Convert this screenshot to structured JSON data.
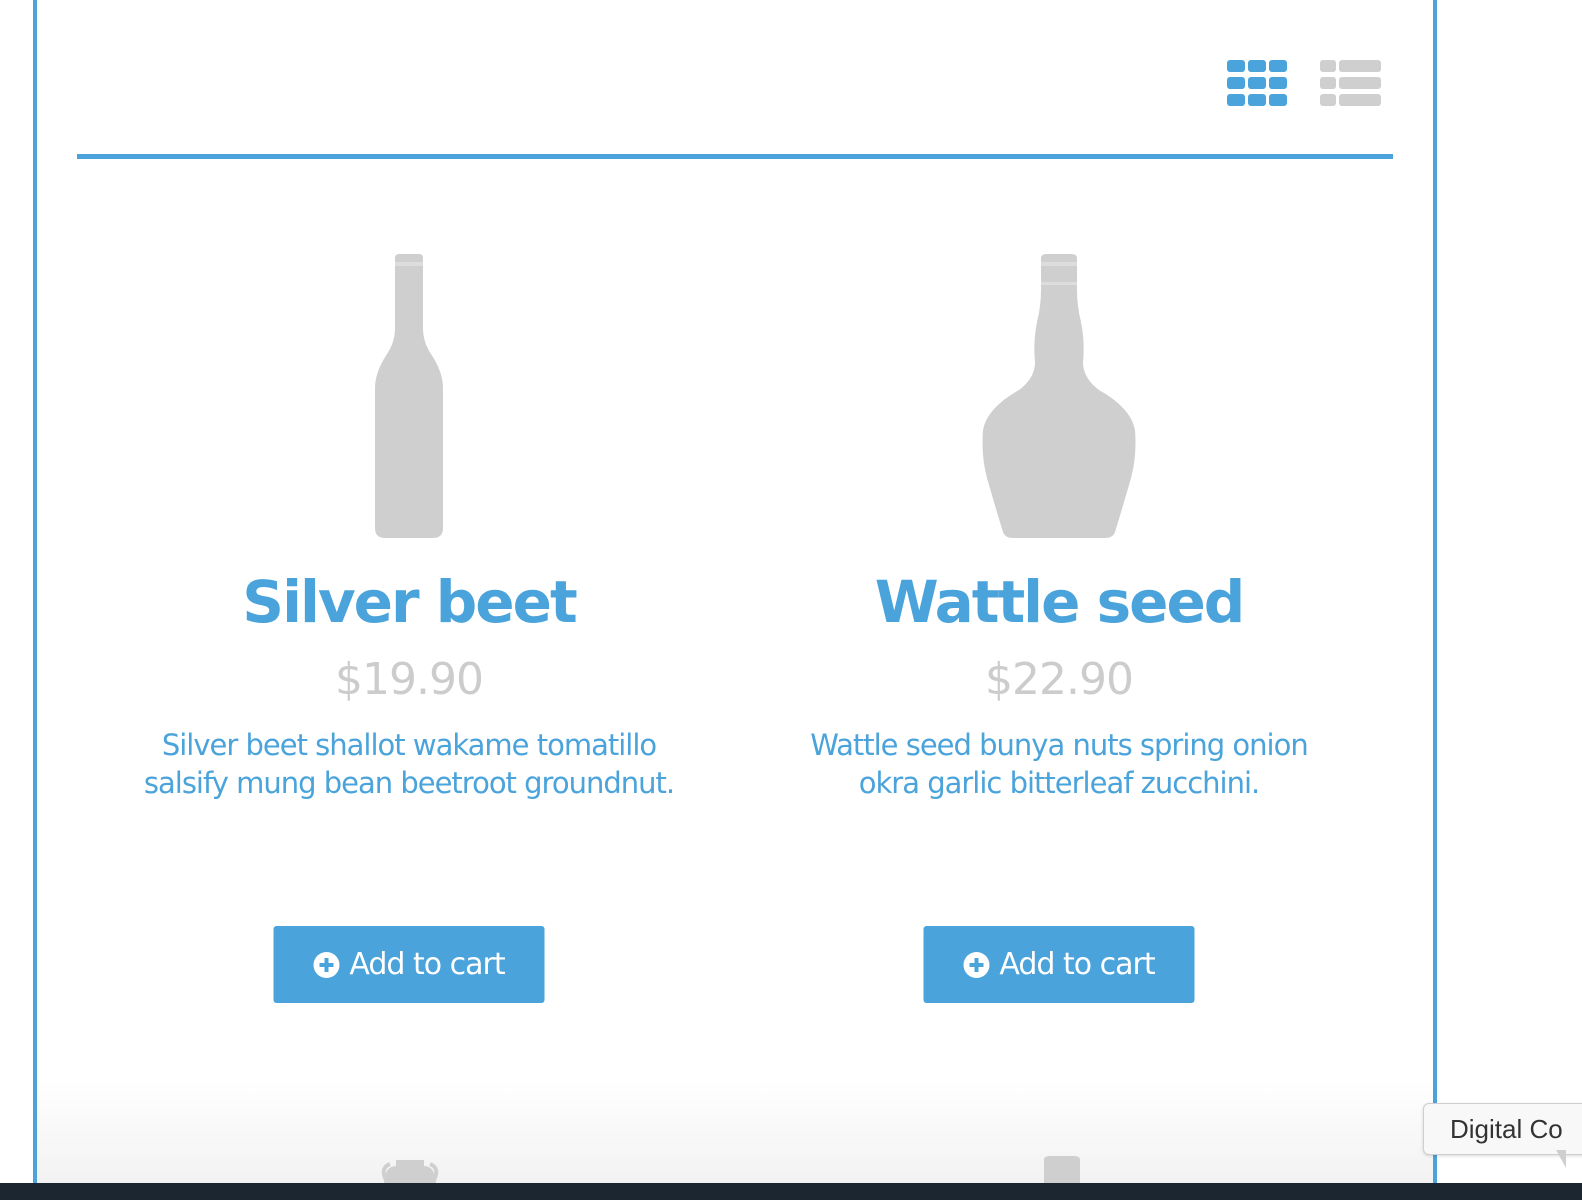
{
  "toolbar": {
    "grid_view_icon": "grid-view-icon",
    "list_view_icon": "list-view-icon",
    "active_view": "grid"
  },
  "products": [
    {
      "title": "Silver beet",
      "price": "$19.90",
      "description": "Silver beet shallot wakame tomatillo salsify mung bean beetroot groundnut.",
      "button_label": "Add to cart",
      "image_icon": "wine-bottle-icon"
    },
    {
      "title": "Wattle seed",
      "price": "$22.90",
      "description": "Wattle seed bunya nuts spring onion okra garlic bitterleaf zucchini.",
      "button_label": "Add to cart",
      "image_icon": "liquor-bottle-icon"
    }
  ],
  "tooltip": {
    "text": "Digital Co"
  },
  "colors": {
    "accent": "#4aa3db",
    "muted": "#cccccc",
    "placeholder_image": "#cfcfcf"
  }
}
